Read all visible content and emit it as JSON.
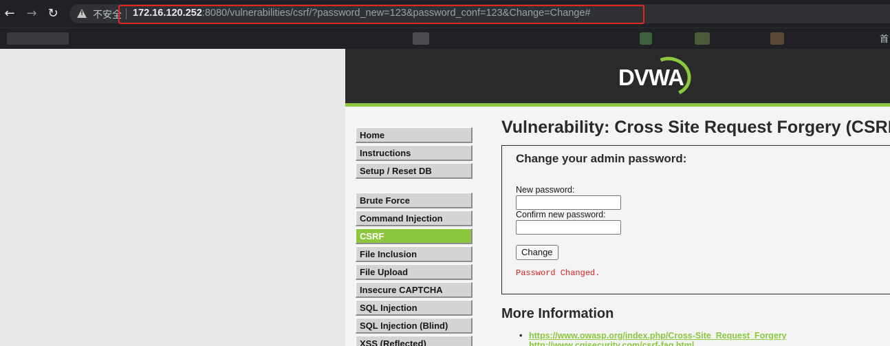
{
  "browser": {
    "insecure_label": "不安全",
    "url_host": "172.16.120.252",
    "url_rest": ":8080/vulnerabilities/csrf/?password_new=123&password_conf=123&Change=Change#",
    "bookmark_edge": "首"
  },
  "logo": {
    "text": "DVWA"
  },
  "menu": {
    "items": [
      "Home",
      "Instructions",
      "Setup / Reset DB",
      "Brute Force",
      "Command Injection",
      "CSRF",
      "File Inclusion",
      "File Upload",
      "Insecure CAPTCHA",
      "SQL Injection",
      "SQL Injection (Blind)",
      "XSS (Reflected)"
    ],
    "selected": "CSRF"
  },
  "main": {
    "title": "Vulnerability: Cross Site Request Forgery (CSRF)",
    "box_heading": "Change your admin password:",
    "new_password_label": "New password:",
    "confirm_password_label": "Confirm new password:",
    "change_button": "Change",
    "result_message": "Password Changed.",
    "more_info_heading": "More Information",
    "links": [
      "https://www.owasp.org/index.php/Cross-Site_Request_Forgery",
      "http://www.cgisecurity.com/csrf-faq.html"
    ]
  },
  "colors": {
    "accent": "#8dc63f",
    "header": "#2a2a2a",
    "error": "#e0201c",
    "highlight": "#e0281c"
  }
}
